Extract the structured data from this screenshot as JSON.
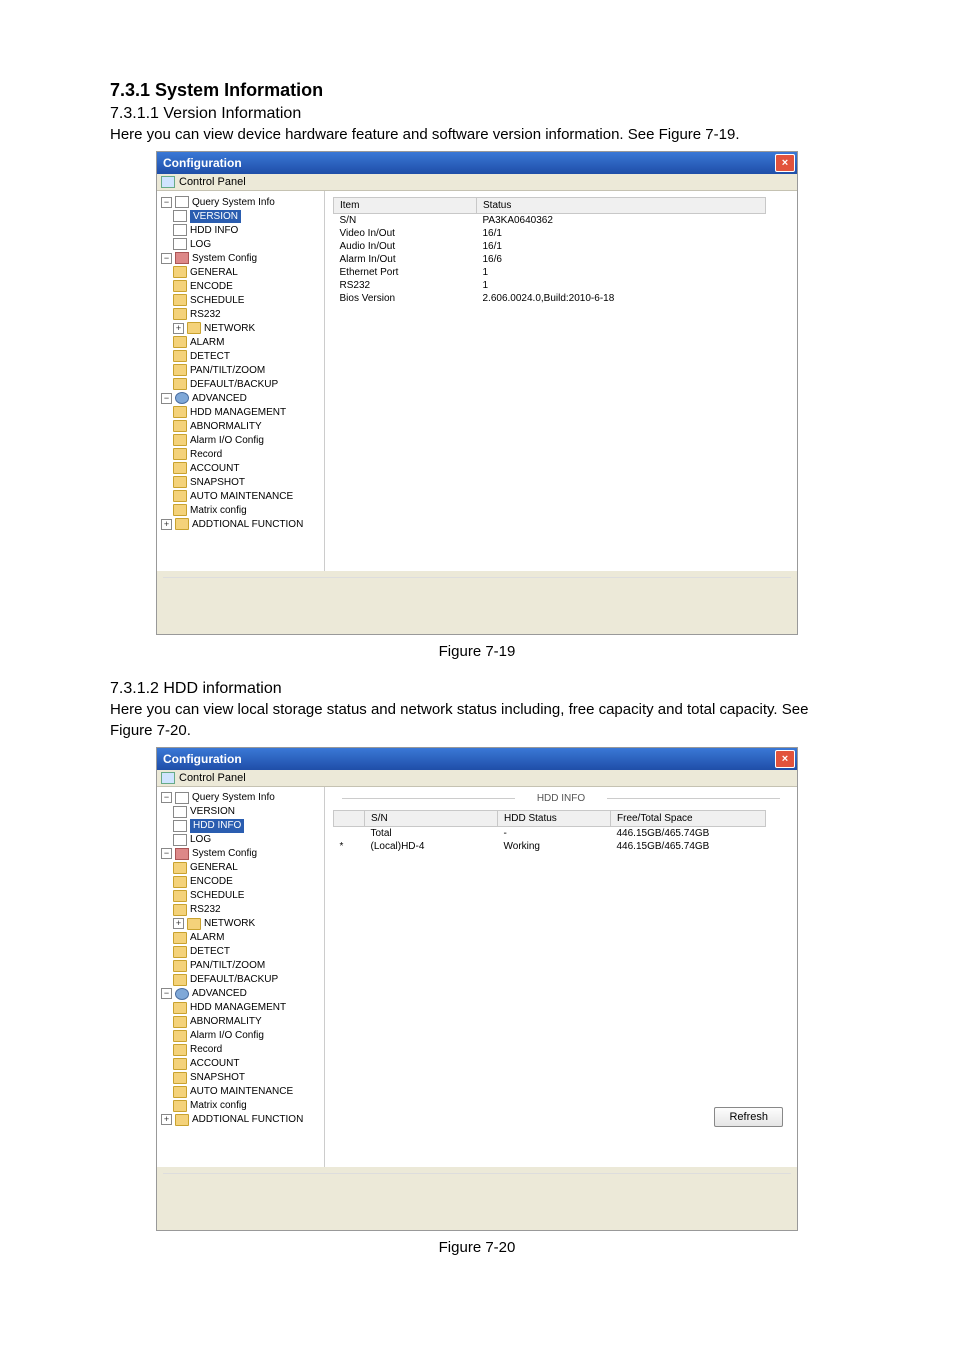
{
  "headings": {
    "h731": "7.3.1  System Information",
    "h7311": "7.3.1.1  Version Information",
    "p7311": "Here you can view device hardware feature and software version information. See Figure 7-19.",
    "cap719": "Figure 7-19",
    "h7312": "7.3.1.2  HDD information",
    "p7312": "Here you can view local storage status and network status including, free capacity and total capacity. See Figure 7-20.",
    "cap720": "Figure 7-20"
  },
  "win": {
    "title": "Configuration",
    "close": "×",
    "control_panel": "Control Panel"
  },
  "tree": {
    "query": "Query System Info",
    "version": "VERSION",
    "hddinfo": "HDD INFO",
    "log": "LOG",
    "sysconfig": "System Config",
    "general": "GENERAL",
    "encode": "ENCODE",
    "schedule": "SCHEDULE",
    "rs232": "RS232",
    "network": "NETWORK",
    "alarm": "ALARM",
    "detect": "DETECT",
    "ptz": "PAN/TILT/ZOOM",
    "defbk": "DEFAULT/BACKUP",
    "advanced": "ADVANCED",
    "hddmgmt": "HDD MANAGEMENT",
    "abnormality": "ABNORMALITY",
    "alarmio": "Alarm I/O Config",
    "record": "Record",
    "account": "ACCOUNT",
    "snapshot": "SNAPSHOT",
    "automaint": "AUTO MAINTENANCE",
    "matrix": "Matrix config",
    "addfunc": "ADDTIONAL FUNCTION"
  },
  "version_table": {
    "headers": {
      "item": "Item",
      "status": "Status"
    },
    "rows": [
      {
        "item": "S/N",
        "status": "PA3KA0640362"
      },
      {
        "item": "Video In/Out",
        "status": "16/1"
      },
      {
        "item": "Audio In/Out",
        "status": "16/1"
      },
      {
        "item": "Alarm In/Out",
        "status": "16/6"
      },
      {
        "item": "Ethernet Port",
        "status": "1"
      },
      {
        "item": "RS232",
        "status": "1"
      },
      {
        "item": "Bios Version",
        "status": "2.606.0024.0,Build:2010-6-18"
      }
    ]
  },
  "hdd_panel": {
    "title": "HDD INFO",
    "headers": {
      "sn": "S/N",
      "status": "HDD Status",
      "space": "Free/Total Space"
    },
    "rows": [
      {
        "sn": "Total",
        "status": "-",
        "space": "446.15GB/465.74GB"
      },
      {
        "sn": "(Local)HD-4",
        "status": "Working",
        "space": "446.15GB/465.74GB",
        "mark": "*"
      }
    ],
    "refresh": "Refresh"
  }
}
